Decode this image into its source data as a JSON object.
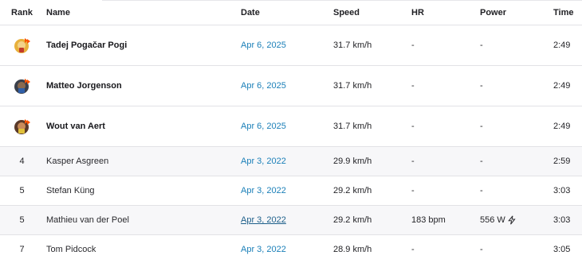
{
  "columns": {
    "rank": "Rank",
    "name": "Name",
    "date": "Date",
    "speed": "Speed",
    "hr": "HR",
    "power": "Power",
    "time": "Time"
  },
  "rows": [
    {
      "rank": "",
      "medal": "gold-trophy-icon",
      "name": "Tadej Pogačar Pogi",
      "date": "Apr 6, 2025",
      "speed": "31.7 km/h",
      "hr": "-",
      "power": "-",
      "time": "2:49"
    },
    {
      "rank": "",
      "medal": "silver-trophy-icon",
      "name": "Matteo Jorgenson",
      "date": "Apr 6, 2025",
      "speed": "31.7 km/h",
      "hr": "-",
      "power": "-",
      "time": "2:49"
    },
    {
      "rank": "",
      "medal": "bronze-trophy-icon",
      "name": "Wout van Aert",
      "date": "Apr 6, 2025",
      "speed": "31.7 km/h",
      "hr": "-",
      "power": "-",
      "time": "2:49"
    },
    {
      "rank": "4",
      "name": "Kasper Asgreen",
      "date": "Apr 3, 2022",
      "speed": "29.9 km/h",
      "hr": "-",
      "power": "-",
      "time": "2:59"
    },
    {
      "rank": "5",
      "name": "Stefan Küng",
      "date": "Apr 3, 2022",
      "speed": "29.2 km/h",
      "hr": "-",
      "power": "-",
      "time": "3:03"
    },
    {
      "rank": "5",
      "name": "Mathieu van der Poel",
      "date": "Apr 3, 2022",
      "speed": "29.2 km/h",
      "hr": "183 bpm",
      "power": "556 W",
      "power_icon": "lightning-bolt-icon",
      "time": "3:03"
    },
    {
      "rank": "7",
      "name": "Tom Pidcock",
      "date": "Apr 3, 2022",
      "speed": "28.9 km/h",
      "hr": "-",
      "power": "-",
      "time": "3:05"
    }
  ],
  "colors": {
    "link": "#1a7fb8",
    "accent_orange": "#fc5200",
    "alt_row": "#f7f7f9",
    "divider": "#e2e2e6"
  }
}
